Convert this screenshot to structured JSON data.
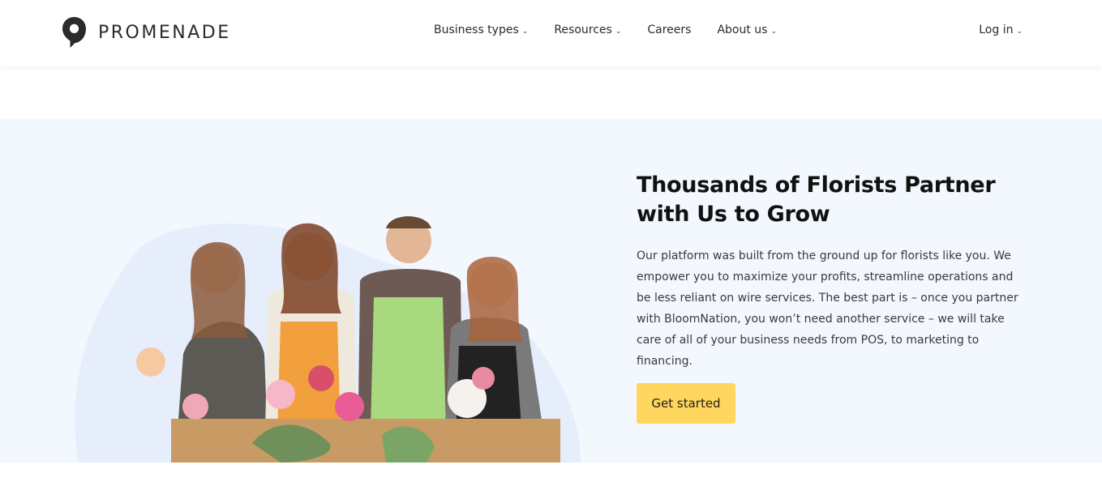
{
  "brand": {
    "name": "PROMENADE",
    "icon": "location-pin-icon"
  },
  "nav": {
    "items": [
      {
        "label": "Business types",
        "has_dropdown": true
      },
      {
        "label": "Resources",
        "has_dropdown": true
      },
      {
        "label": "Careers",
        "has_dropdown": false
      },
      {
        "label": "About us",
        "has_dropdown": true
      }
    ],
    "caret": "⌄",
    "login_label": "Log in"
  },
  "hero": {
    "title": "Thousands of Florists Partner with Us to Grow",
    "body": "Our platform was built from the ground up for florists like you. We empower you to maximize your profits, streamline operations and be less reliant on wire services. The best part is  – once you partner with BloomNation, you won’t need another service  –  we will take care of all of your business needs from POS, to marketing to financing.",
    "cta_label": "Get started",
    "image": "team-of-florists-photo"
  },
  "colors": {
    "hero_background": "#f3f7fe",
    "cta_background": "#ffd65e",
    "text_dark": "#111111"
  }
}
